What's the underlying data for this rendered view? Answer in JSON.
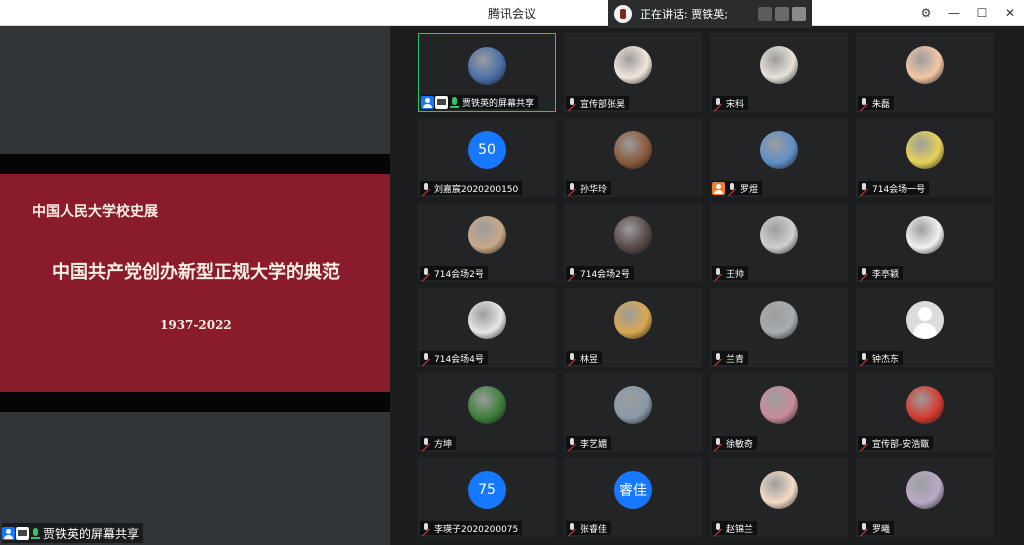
{
  "window": {
    "title": "腾讯会议",
    "speaking_label": "正在讲话: 贾铁英;",
    "buttons": {
      "settings": "⚙",
      "minimize": "—",
      "maximize": "☐",
      "close": "✕"
    }
  },
  "slide": {
    "subtitle": "中国人民大学校史展",
    "title": "中国共产党创办新型正规大学的典范",
    "years": "1937-2022"
  },
  "share_status": {
    "label": "贾铁英的屏幕共享"
  },
  "participants": [
    {
      "name": "贾铁英的屏幕共享",
      "avatar": "photo",
      "color": "#4a6fa8",
      "active": true,
      "icons": [
        "user",
        "screen",
        "mic-on"
      ]
    },
    {
      "name": "宣传部张昊",
      "avatar": "cartoon",
      "color": "#f2e6dc"
    },
    {
      "name": "宋科",
      "avatar": "cartoon",
      "color": "#e8e2da"
    },
    {
      "name": "朱磊",
      "avatar": "cartoon",
      "color": "#f4c7a6"
    },
    {
      "name": "刘嘉宸2020200150",
      "avatar": "number",
      "text": "50"
    },
    {
      "name": "孙华玲",
      "avatar": "photo",
      "color": "#8b5a3c"
    },
    {
      "name": "罗煜",
      "avatar": "photo",
      "color": "#5f8fc7",
      "icons": [
        "user-orange"
      ]
    },
    {
      "name": "714会场一号",
      "avatar": "photo",
      "color": "#e7d257"
    },
    {
      "name": "714会场2号",
      "avatar": "photo",
      "color": "#c9a788"
    },
    {
      "name": "714会场2号",
      "avatar": "photo",
      "color": "#5a4a47"
    },
    {
      "name": "王帅",
      "avatar": "photo",
      "color": "#d0d0d0"
    },
    {
      "name": "李亭颖",
      "avatar": "cartoon",
      "color": "#f2f2f2"
    },
    {
      "name": "714会场4号",
      "avatar": "photo",
      "color": "#e6e6e6"
    },
    {
      "name": "林昱",
      "avatar": "photo",
      "color": "#d9a850"
    },
    {
      "name": "兰青",
      "avatar": "photo",
      "color": "#a8acb0"
    },
    {
      "name": "钟杰东",
      "avatar": "default"
    },
    {
      "name": "方坤",
      "avatar": "photo",
      "color": "#3e7f3a"
    },
    {
      "name": "李艺媚",
      "avatar": "photo",
      "color": "#8a9aa8"
    },
    {
      "name": "徐敏奇",
      "avatar": "photo",
      "color": "#c98b9a"
    },
    {
      "name": "宣传部-安浩甑",
      "avatar": "cartoon",
      "color": "#d63b2f"
    },
    {
      "name": "李瑛子2020200075",
      "avatar": "number",
      "text": "75"
    },
    {
      "name": "张睿佳",
      "avatar": "number",
      "text": "睿佳"
    },
    {
      "name": "赵锦兰",
      "avatar": "cartoon",
      "color": "#f4dcc6"
    },
    {
      "name": "罗曦",
      "avatar": "cartoon",
      "color": "#b9a9c6"
    }
  ]
}
